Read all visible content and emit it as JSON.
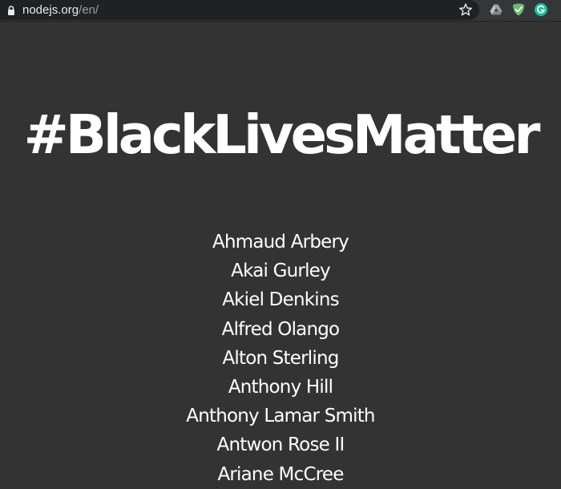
{
  "browser": {
    "url_host": "nodejs.org",
    "url_path": "/en/"
  },
  "icons": {
    "lock": "lock-icon",
    "bookmark": "star-icon",
    "extensions": [
      "google-drive-icon",
      "adguard-shield-icon",
      "grammarly-icon"
    ]
  },
  "colors": {
    "page_background": "#333333",
    "text": "#ffffff",
    "toolbar": "#35363a",
    "omnibox": "#202124",
    "adguard_green": "#68bc71",
    "grammarly_green": "#15c39a"
  },
  "banner": {
    "title": "#BlackLivesMatter",
    "names": [
      "Ahmaud Arbery",
      "Akai Gurley",
      "Akiel Denkins",
      "Alfred Olango",
      "Alton Sterling",
      "Anthony Hill",
      "Anthony Lamar Smith",
      "Antwon Rose II",
      "Ariane McCree"
    ]
  }
}
